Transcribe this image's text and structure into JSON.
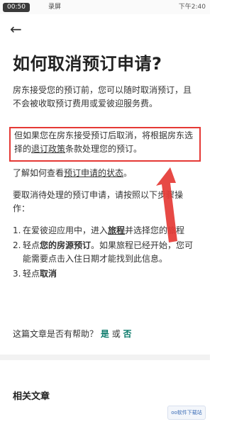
{
  "status_bar": {
    "time": "00:50",
    "recording": "录屏",
    "right": "下午2:40"
  },
  "header": {
    "back_icon": "back-arrow-icon"
  },
  "article": {
    "title": "如何取消预订申请?",
    "p1": "房东接受您的预订前，您可以随时取消预订，且不会被收取预订费用或爱彼迎服务费。",
    "p2_prefix": "但如果您在房东接受预订后取消，将根据房东选择的",
    "p2_link": "退订政策",
    "p2_suffix": "条款处理您的预订。",
    "p3_prefix": "了解如何查看",
    "p3_link": "预订申请的状态",
    "p3_suffix": "。",
    "p4": "要取消待处理的预订申请，请按照以下步骤操作：",
    "steps": [
      {
        "num": "1.",
        "pre": "在爱彼迎应用中，进入",
        "bold": "旅程",
        "post": "并选择您的旅程"
      },
      {
        "num": "2.",
        "pre": "轻点",
        "bold": "您的房源预订",
        "post": "。如果旅程已经开始，您可能需要点击入住日期才能找到此信息。"
      },
      {
        "num": "3.",
        "pre": "轻点",
        "bold": "取消",
        "post": ""
      }
    ]
  },
  "feedback": {
    "question": "这篇文章是否有帮助？",
    "yes": "是",
    "or": "或",
    "no": "否"
  },
  "related": {
    "title": "相关文章"
  },
  "watermark": {
    "text": "oo软件下载站"
  },
  "colors": {
    "highlight": "#e53935",
    "arrow": "#e53935",
    "feedback_link": "#0a7a6a"
  }
}
